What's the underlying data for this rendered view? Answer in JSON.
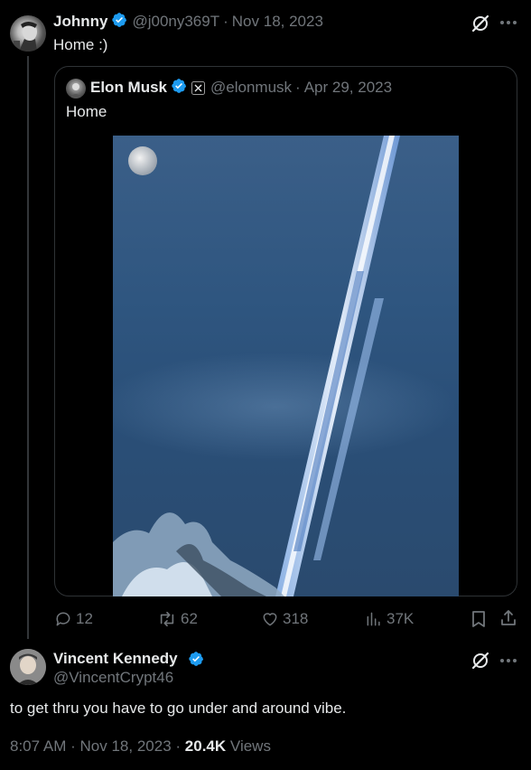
{
  "parent_tweet": {
    "author_name": "Johnny",
    "handle": "@j00ny369T",
    "sep": "·",
    "date": "Nov 18, 2023",
    "text": "Home :)"
  },
  "quoted_tweet": {
    "author_name": "Elon Musk",
    "handle": "@elonmusk",
    "sep": "·",
    "date": "Apr 29, 2023",
    "text": "Home"
  },
  "actions": {
    "replies": "12",
    "reposts": "62",
    "likes": "318",
    "views": "37K"
  },
  "reply_tweet": {
    "author_name": "Vincent Kennedy",
    "handle": "@VincentCrypt46",
    "text": "to get thru you have to go under and around vibe.",
    "time": "8:07 AM",
    "sep": "·",
    "date": "Nov 18, 2023",
    "sep2": "·",
    "views_count": "20.4K",
    "views_label": "Views"
  },
  "colors": {
    "background": "#000000",
    "text": "#e7e9ea",
    "secondary": "#71767b",
    "verified": "#1d9bf0",
    "border": "#2f3336"
  },
  "icons": [
    "verified-badge-icon",
    "grok-icon",
    "more-icon",
    "x-logo-icon",
    "reply-icon",
    "repost-icon",
    "like-icon",
    "views-icon",
    "bookmark-icon",
    "share-icon"
  ]
}
